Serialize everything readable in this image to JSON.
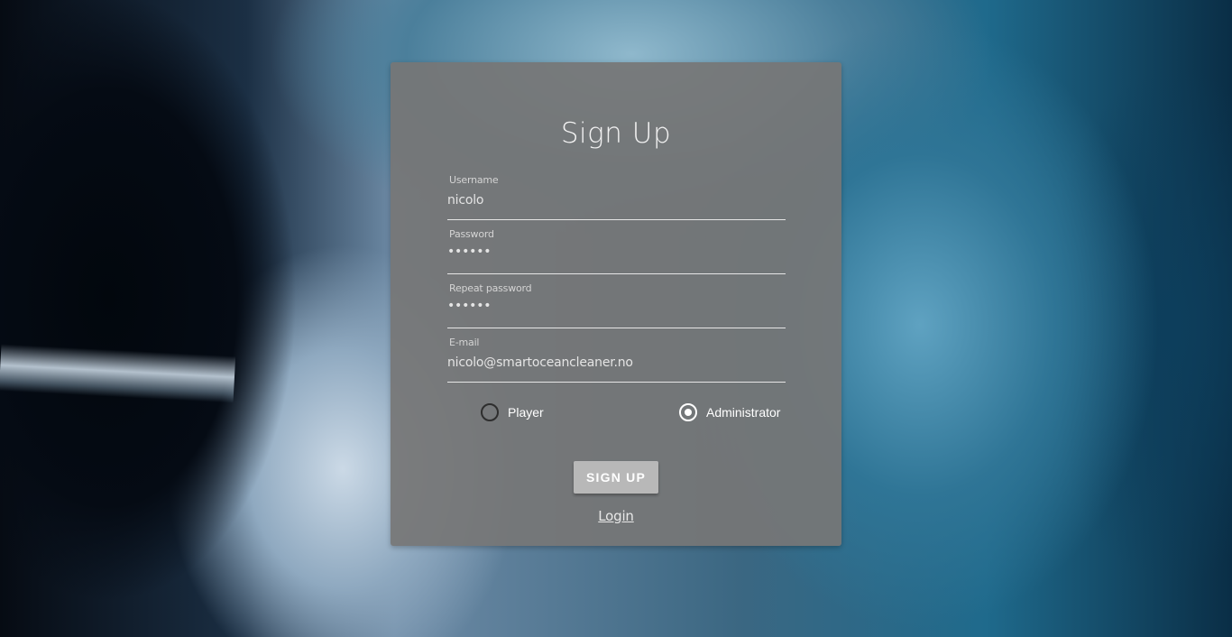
{
  "form": {
    "title": "Sign Up",
    "fields": [
      {
        "label": "Username",
        "value": "nicolo",
        "type": "text"
      },
      {
        "label": "Password",
        "value": "••••••",
        "type": "password"
      },
      {
        "label": "Repeat password",
        "value": "••••••",
        "type": "password"
      },
      {
        "label": "E-mail",
        "value": "nicolo@smartoceancleaner.no",
        "type": "text"
      }
    ],
    "roles": {
      "player_label": "Player",
      "administrator_label": "Administrator",
      "selected": "Administrator"
    },
    "submit_label": "SIGN UP",
    "login_link": "Login"
  },
  "colors": {
    "card_background": "#767676",
    "button_background": "#b8b8b8",
    "text": "#ffffff"
  }
}
